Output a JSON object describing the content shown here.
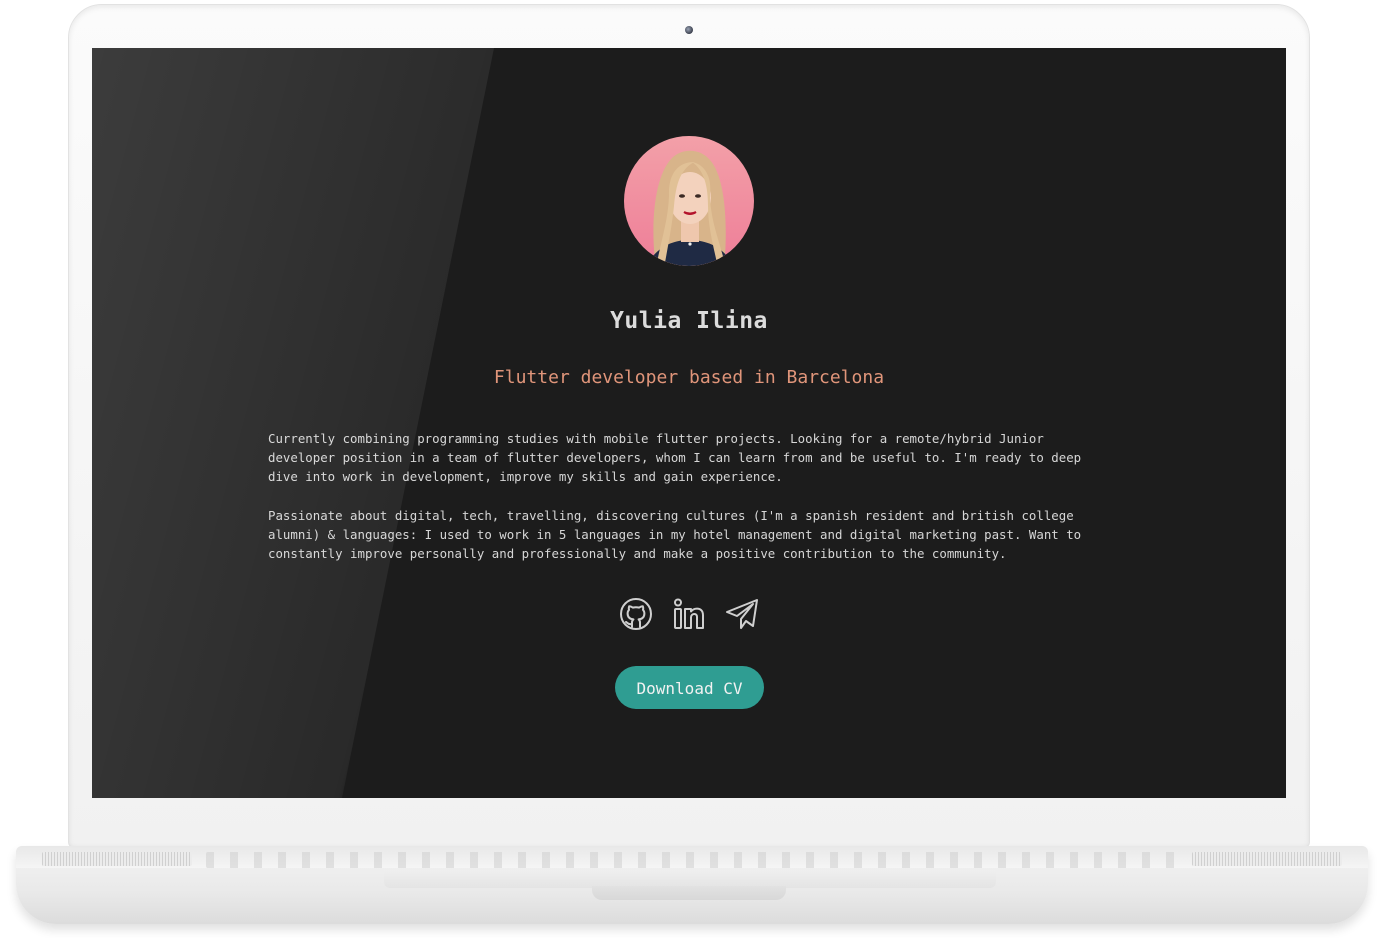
{
  "profile": {
    "name": "Yulia Ilina",
    "subtitle": "Flutter developer based in Barcelona",
    "bio": [
      "Currently combining programming studies with mobile flutter projects. Looking for a remote/hybrid Junior developer position in a team of flutter developers, whom I can learn from and be useful to. I'm ready to deep dive into work in development, improve my skills and gain experience.",
      "Passionate about digital, tech, travelling, discovering cultures (I'm a spanish resident and british college alumni) & languages: I used to work in 5 languages in my hotel management and digital marketing past. Want to constantly improve personally and professionally and make a positive contribution to the community."
    ]
  },
  "socials": [
    {
      "icon": "github-icon"
    },
    {
      "icon": "linkedin-icon"
    },
    {
      "icon": "telegram-icon"
    }
  ],
  "cta": {
    "label": "Download CV"
  },
  "colors": {
    "background": "#1c1c1c",
    "name": "#dcdcdc",
    "subtitle": "#e0957a",
    "text": "#d6d6d6",
    "button": "#2f9d92",
    "avatar_bg": "#f08aa0"
  }
}
